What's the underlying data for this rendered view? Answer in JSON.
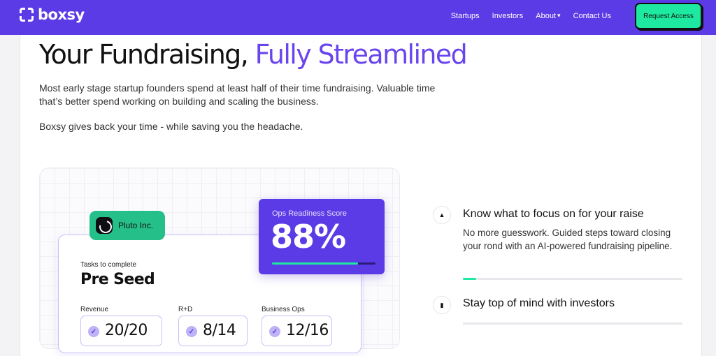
{
  "nav": {
    "brand": "boxsy",
    "links": [
      "Startups",
      "Investors",
      "About",
      "Contact Us"
    ],
    "cta": "Request Access"
  },
  "hero": {
    "title_main": "Your Fundraising, ",
    "title_accent": "Fully Streamlined",
    "intro": "Most early stage startup founders spend at least half of their time fundraising. Valuable time that’s better spend working on building and scaling the business.",
    "intro2": "Boxsy gives back your time - while saving you the headache."
  },
  "dashboard": {
    "company": "Pluto Inc.",
    "tasks_label": "Tasks to complete",
    "stage": "Pre Seed",
    "metrics": [
      {
        "label": "Revenue",
        "value": "20/20"
      },
      {
        "label": "R+D",
        "value": "8/14"
      },
      {
        "label": "Business Ops",
        "value": "12/16"
      }
    ],
    "score": {
      "label": "Ops Readiness Score",
      "value": "88%",
      "progress": 0.83
    }
  },
  "features": [
    {
      "title": "Know what to focus on for your raise",
      "desc": "No more guesswork. Guided steps toward closing your rond with an AI-powered fundraising pipeline.",
      "progress": 0.06
    },
    {
      "title": "Stay top of mind with investors",
      "progress": 0
    }
  ],
  "colors": {
    "brand": "#5b3be6",
    "accent": "#1de9a0",
    "title_accent": "#6a45ee"
  }
}
